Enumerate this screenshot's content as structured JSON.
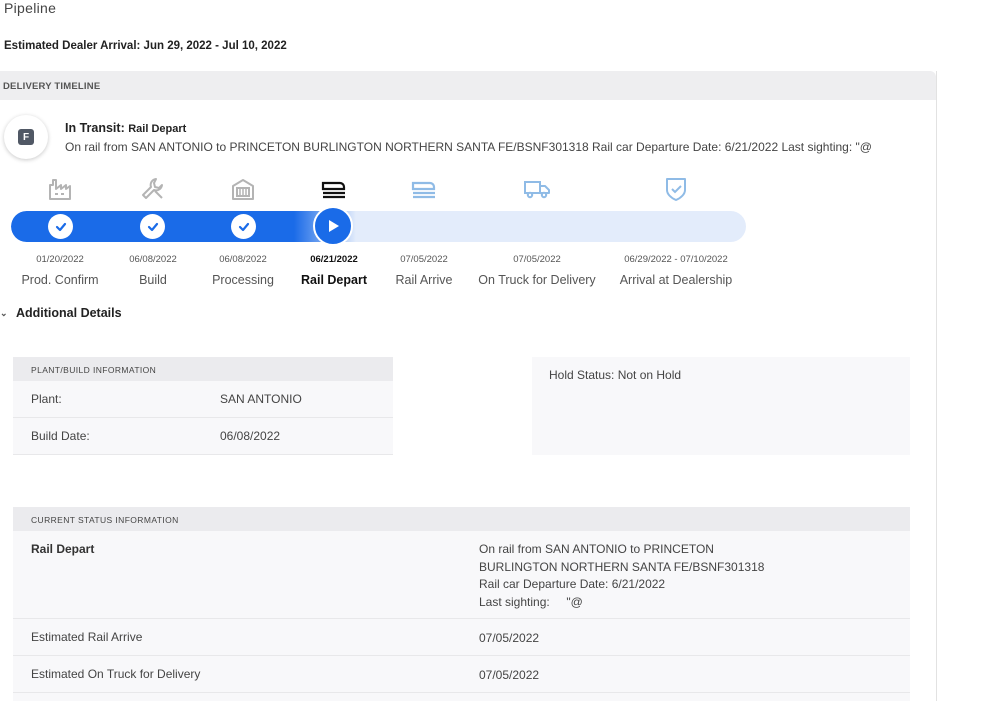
{
  "page": {
    "title": "Pipeline",
    "estimated_arrival": "Estimated Dealer Arrival: Jun 29, 2022 - Jul 10, 2022"
  },
  "timeline": {
    "header": "DELIVERY TIMELINE",
    "badge_letter": "F",
    "status_title": "In Transit:",
    "status_subtitle": "Rail Depart",
    "status_description": "On rail from SAN ANTONIO to PRINCETON BURLINGTON NORTHERN SANTA FE/BSNF301318 Rail car Departure Date: 6/21/2022 Last sighting: \"@",
    "progress_fraction": 0.47,
    "stages": [
      {
        "icon": "factory-icon",
        "date": "01/20/2022",
        "label": "Prod. Confirm",
        "state": "complete"
      },
      {
        "icon": "wrench-icon",
        "date": "06/08/2022",
        "label": "Build",
        "state": "complete"
      },
      {
        "icon": "processing-icon",
        "date": "06/08/2022",
        "label": "Processing",
        "state": "complete"
      },
      {
        "icon": "rail-depart-icon",
        "date": "06/21/2022",
        "label": "Rail Depart",
        "state": "current"
      },
      {
        "icon": "rail-arrive-icon",
        "date": "07/05/2022",
        "label": "Rail Arrive",
        "state": "upcoming"
      },
      {
        "icon": "truck-icon",
        "date": "07/05/2022",
        "label": "On Truck for Delivery",
        "state": "upcoming"
      },
      {
        "icon": "shield-check-icon",
        "date": "06/29/2022 - 07/10/2022",
        "label": "Arrival at Dealership",
        "state": "upcoming"
      }
    ],
    "accent_color": "#1a6be8",
    "upcoming_icon_color": "#8fbbe6"
  },
  "additional_details": {
    "label": "Additional Details"
  },
  "plant_info": {
    "header": "PLANT/BUILD INFORMATION",
    "rows": [
      {
        "key": "Plant:",
        "value": "SAN ANTONIO"
      },
      {
        "key": "Build Date:",
        "value": "06/08/2022"
      }
    ]
  },
  "hold": {
    "text": "Hold Status: Not on Hold"
  },
  "current_status": {
    "header": "CURRENT STATUS INFORMATION",
    "main_key": "Rail Depart",
    "main_lines": [
      "On rail from SAN ANTONIO to PRINCETON",
      "BURLINGTON NORTHERN SANTA FE/BSNF301318",
      "Rail car Departure Date: 6/21/2022",
      "Last sighting:     \"@"
    ],
    "rows": [
      {
        "key": "Estimated Rail Arrive",
        "value": "07/05/2022"
      },
      {
        "key": "Estimated On Truck for Delivery",
        "value": "07/05/2022"
      }
    ]
  }
}
